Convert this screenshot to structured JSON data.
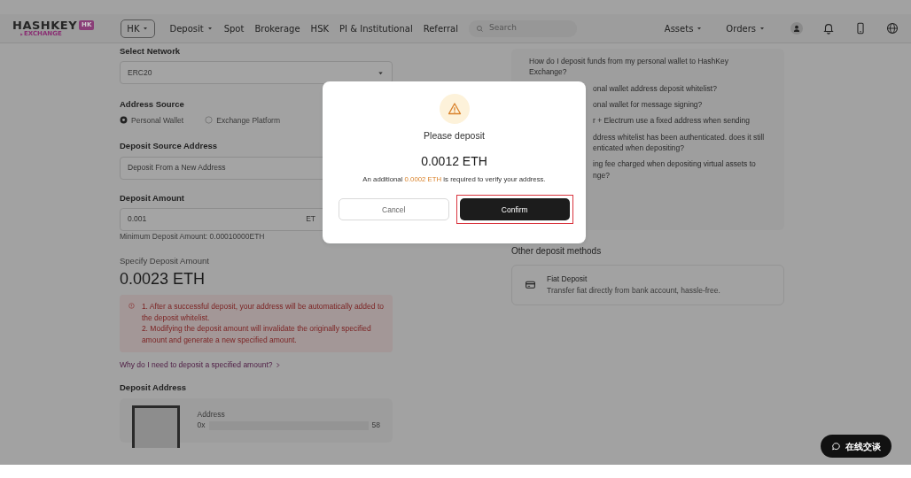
{
  "nav": {
    "logo": {
      "name": "HASHKEY",
      "badge": "HK",
      "tagline": "EXCHANGE"
    },
    "region": {
      "label": "HK",
      "dropdown": true
    },
    "menu": [
      {
        "label": "Deposit",
        "dropdown": true
      },
      {
        "label": "Spot",
        "dropdown": false
      },
      {
        "label": "Brokerage",
        "dropdown": false
      },
      {
        "label": "HSK",
        "dropdown": false
      },
      {
        "label": "PI & Institutional",
        "dropdown": false
      },
      {
        "label": "Referral",
        "dropdown": false
      }
    ],
    "search": {
      "placeholder": "Search"
    },
    "right_menu": [
      {
        "label": "Assets",
        "dropdown": true
      },
      {
        "label": "Orders",
        "dropdown": true
      }
    ]
  },
  "form": {
    "network": {
      "label": "Select Network",
      "value": "ERC20"
    },
    "address_source": {
      "label": "Address Source",
      "options": [
        {
          "label": "Personal Wallet",
          "selected": true
        },
        {
          "label": "Exchange Platform",
          "selected": false
        }
      ]
    },
    "source_address": {
      "label": "Deposit Source Address",
      "value": "Deposit From a New Address"
    },
    "amount": {
      "label": "Deposit Amount",
      "value": "0.001",
      "suffix": "ET",
      "hint": "Minimum Deposit Amount: 0.00010000ETH"
    },
    "specified": {
      "label": "Specify Deposit Amount",
      "value": "0.0023 ETH"
    },
    "warnings": [
      "1. After a successful deposit, your address will be automatically added to the deposit whitelist.",
      "2. Modifying the deposit amount will invalidate the originally specified amount and generate a new specified amount."
    ],
    "why_link": "Why do I need to deposit a specified amount?",
    "deposit_address": {
      "label": "Deposit Address",
      "field_label": "Address",
      "start": "0x",
      "end": "58"
    }
  },
  "faq": [
    {
      "lines": [
        "How do I deposit funds from my personal wallet to HashKey Exchange?"
      ],
      "partial": false
    },
    {
      "lines": [
        "onal wallet address deposit whitelist?"
      ],
      "partial": true
    },
    {
      "lines": [
        "onal wallet for message signing?"
      ],
      "partial": true
    },
    {
      "lines": [
        "r + Electrum use a fixed address when sending"
      ],
      "partial": true
    },
    {
      "lines": [
        "ddress whitelist has been authenticated. does it still",
        "enticated when depositing?"
      ],
      "partial": true
    },
    {
      "lines": [
        "ing fee charged when depositing virtual assets to",
        "nge?"
      ],
      "partial": true
    }
  ],
  "other_methods": {
    "title": "Other deposit methods",
    "items": [
      {
        "title": "Fiat Deposit",
        "description": "Transfer fiat directly from bank account, hassle-free."
      }
    ]
  },
  "modal": {
    "title": "Please deposit",
    "amount": "0.0012 ETH",
    "note_before": "An additional",
    "note_highlight": "0.0002 ETH",
    "note_after": "is required to verify your address.",
    "buttons": [
      {
        "label": "Cancel",
        "kind": "secondary",
        "highlighted": false
      },
      {
        "label": "Confirm",
        "kind": "primary",
        "highlighted": true
      }
    ]
  },
  "chat": {
    "label": "在线交谈"
  }
}
